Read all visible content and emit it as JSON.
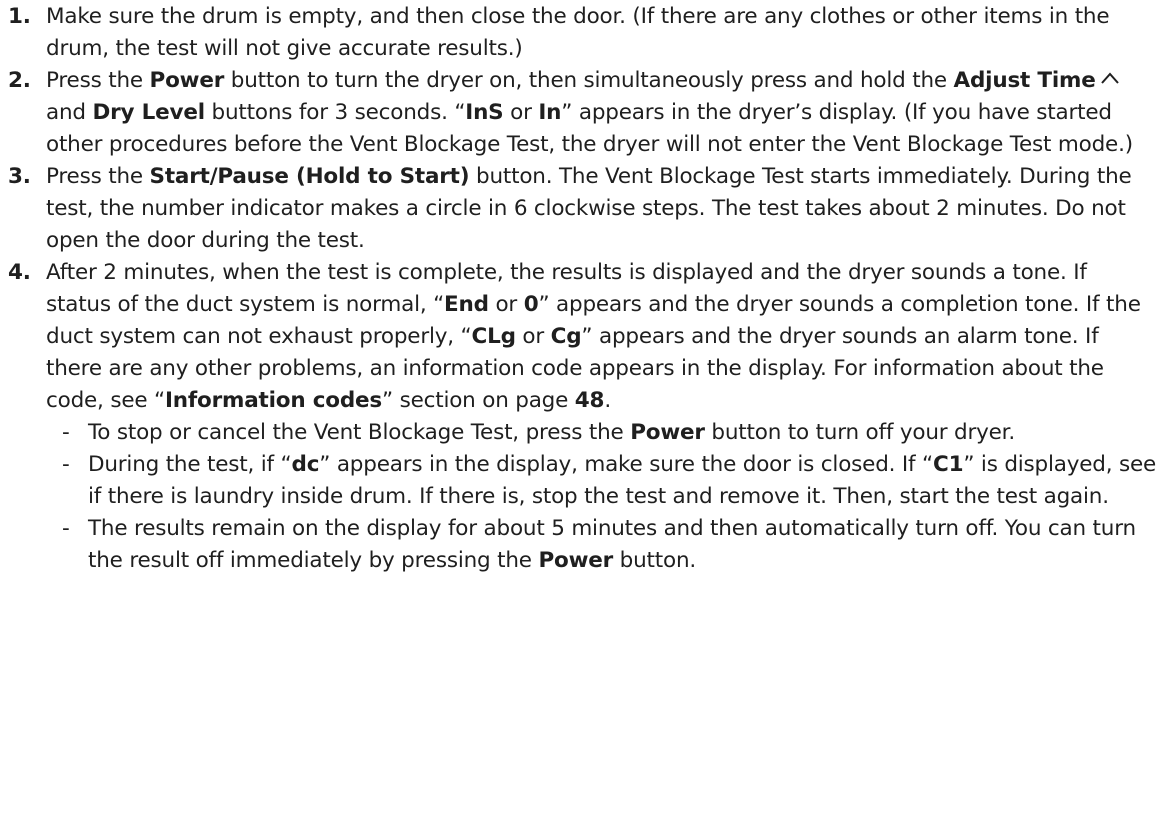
{
  "steps": [
    {
      "num": "1.",
      "segments": [
        {
          "t": "Make sure the drum is empty, and then close the door. (If there are any clothes or other items in the drum, the test will not give accurate results.)"
        }
      ]
    },
    {
      "num": "2.",
      "segments": [
        {
          "t": "Press the "
        },
        {
          "t": "Power",
          "b": true
        },
        {
          "t": " button to turn the dryer on, then simultaneously press and hold the "
        },
        {
          "t": "Adjust Time",
          "b": true
        },
        {
          "icon": "caret-up-icon"
        },
        {
          "t": " and "
        },
        {
          "t": "Dry Level",
          "b": true
        },
        {
          "t": " buttons for 3 seconds. “"
        },
        {
          "t": "InS",
          "b": true
        },
        {
          "t": " or "
        },
        {
          "t": "In",
          "b": true
        },
        {
          "t": "” appears in the dryer’s display. (If you have started other procedures before the Vent Blockage Test, the dryer will not enter the Vent Blockage Test mode.)"
        }
      ]
    },
    {
      "num": "3.",
      "segments": [
        {
          "t": "Press the "
        },
        {
          "t": "Start/Pause (Hold to Start)",
          "b": true
        },
        {
          "t": " button. The Vent Blockage Test starts immediately. During the test, the number indicator makes a circle in 6 clockwise steps. The test takes about 2 minutes. Do not open the door during the test."
        }
      ]
    },
    {
      "num": "4.",
      "segments": [
        {
          "t": "After 2 minutes, when the test is complete, the results is displayed and the dryer sounds a tone. If status of the duct system is normal, “"
        },
        {
          "t": "End",
          "b": true
        },
        {
          "t": " or "
        },
        {
          "t": "0",
          "b": true
        },
        {
          "t": "” appears and the dryer sounds a completion tone. If the duct system can not exhaust properly, “"
        },
        {
          "t": "CLg",
          "b": true
        },
        {
          "t": " or "
        },
        {
          "t": "Cg",
          "b": true
        },
        {
          "t": "” appears and the dryer sounds an alarm tone. If there are any other problems, an information code appears in the display. For information about the code, see “"
        },
        {
          "t": "Information codes",
          "b": true
        },
        {
          "t": "” section on page "
        },
        {
          "t": "48",
          "b": true
        },
        {
          "t": "."
        }
      ]
    }
  ],
  "subitems": [
    {
      "dash": "-",
      "segments": [
        {
          "t": "To stop or cancel the Vent Blockage Test, press the "
        },
        {
          "t": "Power",
          "b": true
        },
        {
          "t": " button to turn off your dryer."
        }
      ]
    },
    {
      "dash": "-",
      "segments": [
        {
          "t": "During the test, if “"
        },
        {
          "t": "dc",
          "b": true
        },
        {
          "t": "” appears in the display, make sure the door is closed. If “"
        },
        {
          "t": "C1",
          "b": true
        },
        {
          "t": "” is displayed, see if there is laundry inside drum. If there is, stop the test and remove it. Then, start the test again."
        }
      ]
    },
    {
      "dash": "-",
      "segments": [
        {
          "t": "The results remain on the display for about 5 minutes and then automatically turn off. You can turn the result off immediately by pressing the "
        },
        {
          "t": "Power",
          "b": true
        },
        {
          "t": " button."
        }
      ]
    }
  ]
}
